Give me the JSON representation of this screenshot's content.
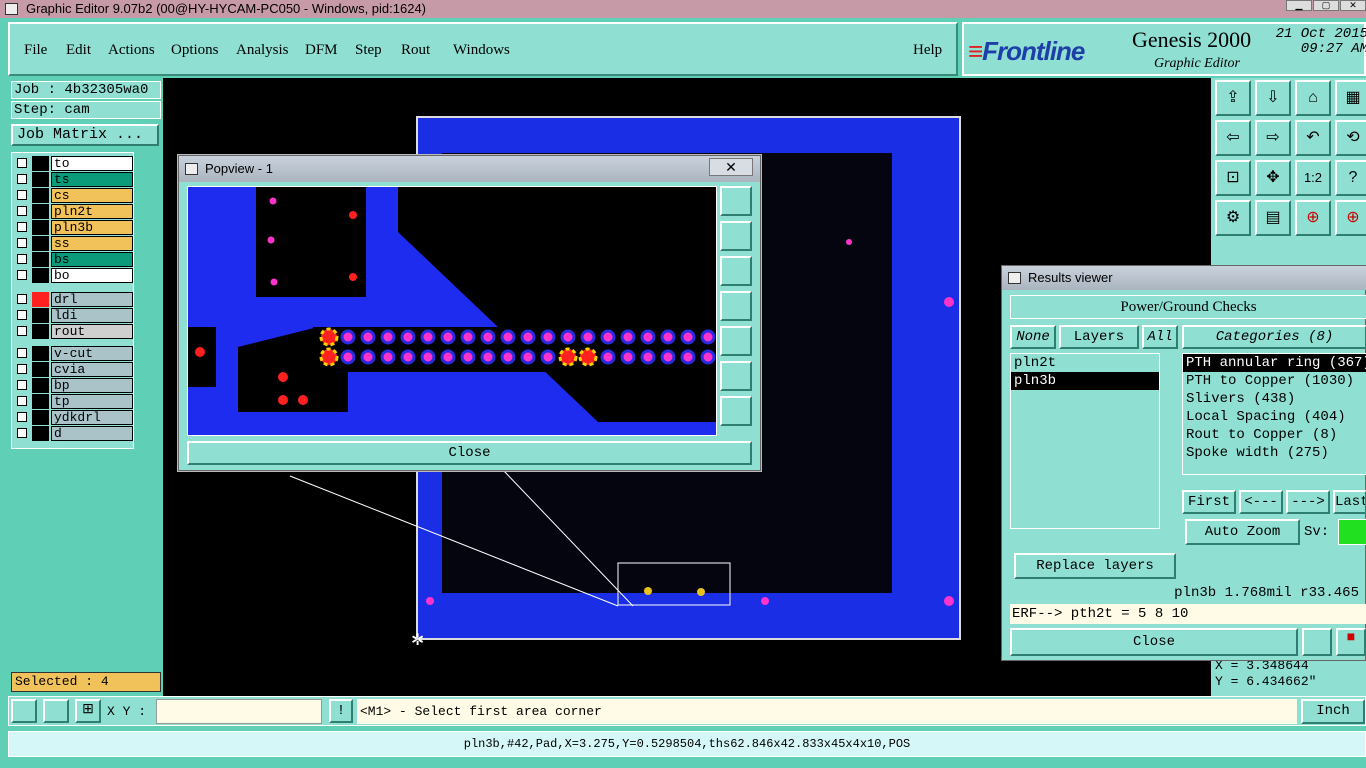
{
  "window": {
    "title": "Graphic Editor 9.07b2 (00@HY-HYCAM-PC050 - Windows, pid:1624)"
  },
  "menu": {
    "items": [
      "File",
      "Edit",
      "Actions",
      "Options",
      "Analysis",
      "DFM",
      "Step",
      "Rout",
      "Windows"
    ],
    "help": "Help"
  },
  "brand": {
    "logo_text": "Frontline",
    "product": "Genesis 2000",
    "subtitle": "Graphic Editor",
    "date": "21 Oct 2015",
    "time": "09:27 AM"
  },
  "job": {
    "job_label": "Job : 4b32305wa0",
    "step_label": "Step: cam",
    "matrix_button": "Job Matrix ..."
  },
  "layers": [
    {
      "name": "to",
      "color": "#ffffff"
    },
    {
      "name": "ts",
      "color": "#0c9b7a"
    },
    {
      "name": "cs",
      "color": "#f2c25a"
    },
    {
      "name": "pln2t",
      "color": "#f2c25a"
    },
    {
      "name": "pln3b",
      "color": "#f2c25a"
    },
    {
      "name": "ss",
      "color": "#f2c25a"
    },
    {
      "name": "bs",
      "color": "#0c9b7a"
    },
    {
      "name": "bo",
      "color": "#ffffff"
    },
    {
      "name": "drl",
      "color": "#a9c3c9"
    },
    {
      "name": "ldi",
      "color": "#a9c3c9"
    },
    {
      "name": "rout",
      "color": "#cfcfcf"
    },
    {
      "name": "v-cut",
      "color": "#a9c3c9"
    },
    {
      "name": "cvia",
      "color": "#a9c3c9"
    },
    {
      "name": "bp",
      "color": "#a9c3c9"
    },
    {
      "name": "tp",
      "color": "#a9c3c9"
    },
    {
      "name": "ydkdrl",
      "color": "#a9c3c9"
    },
    {
      "name": "d",
      "color": "#a9c3c9"
    }
  ],
  "selected_label": "Selected : 4",
  "popview": {
    "title": "Popview - 1",
    "close_label": "Close",
    "close_x": "✕"
  },
  "results": {
    "title": "Results viewer",
    "header": "Power/Ground Checks",
    "none_label": "None",
    "layers_label": "Layers",
    "all_label": "All",
    "categories_label": "Categories (8)",
    "layer_items": [
      "pln2t",
      "pln3b"
    ],
    "selected_layer": "pln3b",
    "categories": [
      "PTH annular ring (367)",
      "PTH to Copper (1030)",
      "Slivers (438)",
      "Local Spacing (404)",
      "Rout to Copper (8)",
      "Spoke width (275)"
    ],
    "nav": [
      "First",
      "<---",
      "--->",
      "Last"
    ],
    "auto_zoom": "Auto Zoom",
    "sv_label": "Sv:",
    "replace_layers": "Replace layers",
    "measure": "pln3b 1.768mil  r33.465",
    "erf": "ERF--> pth2t = 5 8 10",
    "close_label": "Close"
  },
  "coords": {
    "x": "X = 3.348644",
    "y": "Y = 6.434662\""
  },
  "bottom": {
    "xy_label": "X Y :",
    "xy_value": "",
    "prompt": "<M1> - Select first area corner",
    "units": "Inch"
  },
  "status": "pln3b,#42,Pad,X=3.275,Y=0.5298504,ths62.846x42.833x45x4x10,POS"
}
